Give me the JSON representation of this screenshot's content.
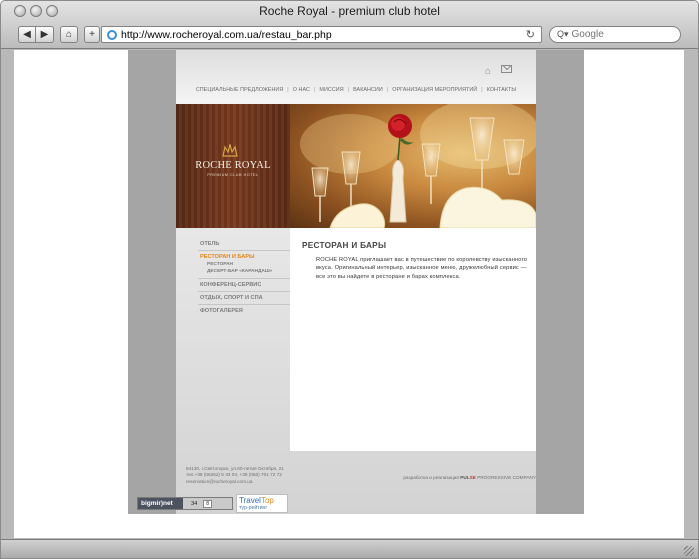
{
  "browser": {
    "window_title": "Roche Royal - premium club hotel",
    "url": "http://www.rocheroyal.com.ua/restau_bar.php",
    "search_placeholder": "Google",
    "back_glyph": "◀",
    "forward_glyph": "▶",
    "home_glyph": "⌂",
    "add_glyph": "+",
    "reload_glyph": "↻",
    "search_glyph": "Q▾"
  },
  "site": {
    "top_nav": [
      "СПЕЦИАЛЬНЫЕ ПРЕДЛОЖЕНИЯ",
      "О НАС",
      "МИССИЯ",
      "ВАКАНСИИ",
      "ОРГАНИЗАЦИЯ МЕРОПРИЯТИЙ",
      "КОНТАКТЫ"
    ],
    "logo": {
      "name": "ROCHE ROYAL",
      "tagline": "PREMIUM CLUB HOTEL"
    },
    "left_nav": {
      "hotel": "ОТЕЛЬ",
      "restaurants": "РЕСТОРАН И БАРЫ",
      "restaurants_sub": [
        "РЕСТОРАН",
        "ДЕСЕРТ-БАР «КАРАНДАШ»"
      ],
      "conference": "КОНФЕРЕНЦ-СЕРВИС",
      "leisure": "ОТДЫХ, СПОРТ И СПА",
      "gallery": "ФОТОГАЛЕРЕЯ"
    },
    "content": {
      "title": "РЕСТОРАН И БАРЫ",
      "text": "ROCHE ROYAL приглашает вас в путешествие по королевству изысканного вкуса. Оригинальный интерьер, изысканное меню, дружелюбный сервис — все это вы найдете в ресторане и барах комплекса."
    },
    "footer": {
      "address_line1": "84130, г.Святогорск, ул.60-летия Октября, 21",
      "address_line2": "тел.+38 (06262) 5 33 03, +38 (050) 701 72 72",
      "address_line3": "reservation@rocheroyal.com.ua",
      "dev_prefix": "разработка и реализация",
      "dev_company_a": "PUL",
      "dev_company_b": "SE",
      "dev_company_c": "PROGRESSIVE COMPANY"
    },
    "counters": {
      "bigmir_label": "bigmir)net",
      "bigmir_count": "34",
      "bigmir_box": "8",
      "traveltop_a": "Travel",
      "traveltop_b": "Top",
      "traveltop_sub": "тур-рейтинг"
    }
  },
  "colors": {
    "accent_orange": "#e2871c",
    "banner_wood": "#6b3219",
    "frame_gray": "#a5a5a5"
  }
}
